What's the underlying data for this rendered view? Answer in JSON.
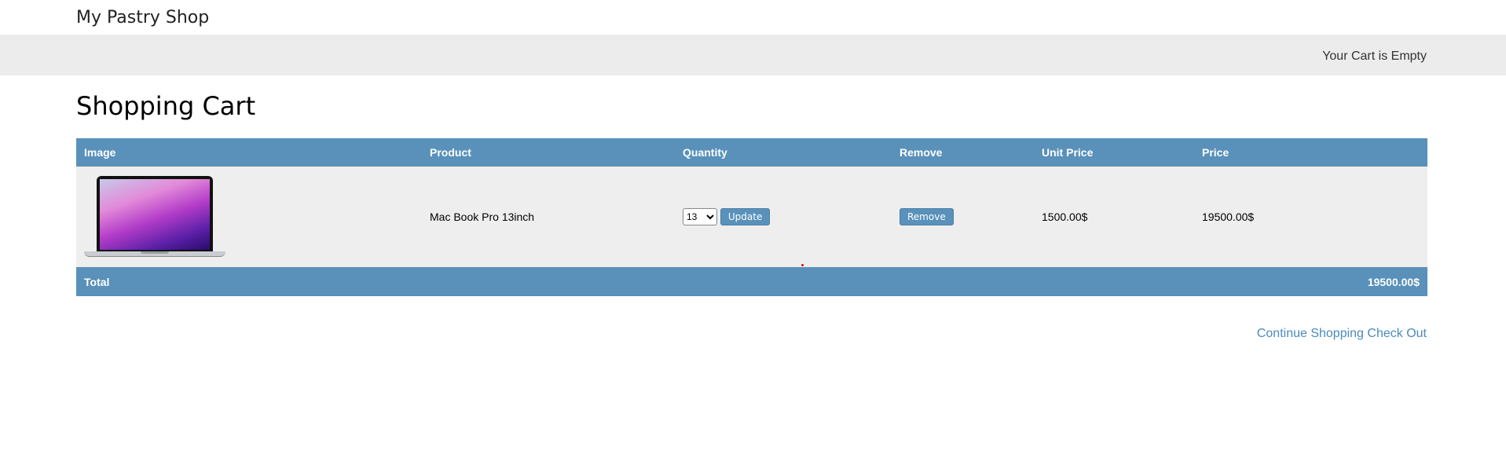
{
  "header": {
    "brand": "My Pastry Shop"
  },
  "cart_bar": {
    "status": "Your Cart is Empty"
  },
  "page": {
    "title": "Shopping Cart"
  },
  "table": {
    "columns": [
      "Image",
      "Product",
      "Quantity",
      "Remove",
      "Unit Price",
      "Price"
    ],
    "rows": [
      {
        "image_icon": "laptop-image",
        "product": "Mac Book Pro 13inch",
        "quantity": "13",
        "update_label": "Update",
        "remove_label": "Remove",
        "unit_price": "1500.00$",
        "price": "19500.00$"
      }
    ],
    "total_label": "Total",
    "total_value": "19500.00$"
  },
  "links": {
    "continue_shopping": "Continue Shopping",
    "check_out": "Check Out"
  },
  "colors": {
    "accent": "#5991ba",
    "row_bg": "#eeeeee",
    "bar_bg": "#ececec",
    "link": "#4a8ac0"
  }
}
